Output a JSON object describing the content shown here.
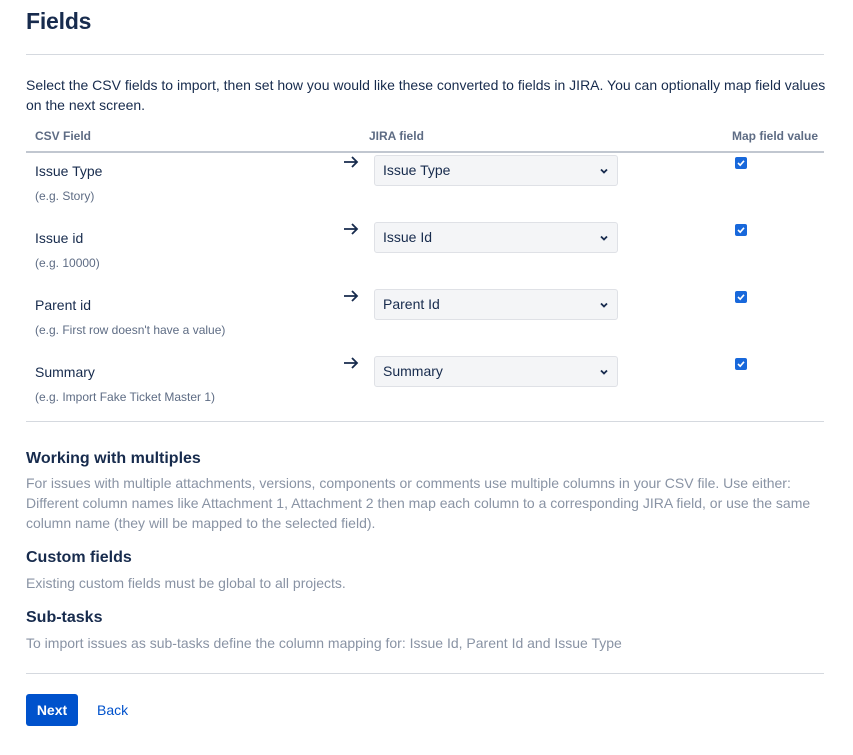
{
  "page": {
    "title": "Fields",
    "intro": "Select the CSV fields to import, then set how you would like these converted to fields in JIRA. You can optionally map field values on the next screen."
  },
  "table": {
    "headers": {
      "csv_field": "CSV Field",
      "jira_field": "JIRA field",
      "map_value": "Map field value"
    },
    "rows": [
      {
        "label": "Issue Type",
        "example": "(e.g. Story)",
        "jira_field": "Issue Type",
        "map_checked": true
      },
      {
        "label": "Issue id",
        "example": "(e.g. 10000)",
        "jira_field": "Issue Id",
        "map_checked": true
      },
      {
        "label": "Parent id",
        "example": "(e.g. First row doesn't have a value)",
        "jira_field": "Parent Id",
        "map_checked": true
      },
      {
        "label": "Summary",
        "example": "(e.g. Import Fake Ticket Master 1)",
        "jira_field": "Summary",
        "map_checked": true
      }
    ]
  },
  "help": {
    "multiples": {
      "title": "Working with multiples",
      "text": "For issues with multiple attachments, versions, components or comments use multiple columns in your CSV file. Use either: Different column names like Attachment 1, Attachment 2 then map each column to a corresponding JIRA field, or use the same column name (they will be mapped to the selected field)."
    },
    "custom_fields": {
      "title": "Custom fields",
      "text": "Existing custom fields must be global to all projects."
    },
    "subtasks": {
      "title": "Sub-tasks",
      "text": "To import issues as sub-tasks define the column mapping for: Issue Id, Parent Id and Issue Type"
    }
  },
  "actions": {
    "next_label": "Next",
    "back_label": "Back"
  },
  "colors": {
    "primary": "#0052cc",
    "checkbox": "#1868db",
    "text": "#172b4d",
    "muted": "#8993a4"
  }
}
